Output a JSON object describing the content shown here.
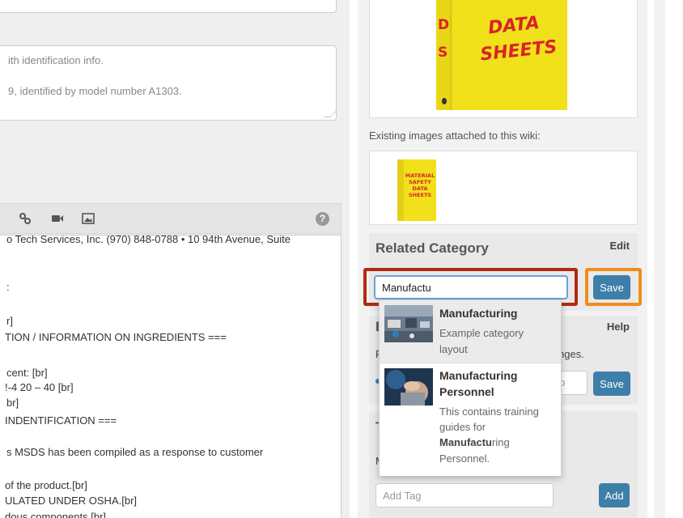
{
  "left": {
    "summary_line1": "ith identification info.",
    "summary_line2": "9, identified by model number A1303.",
    "help_icon": "?",
    "editor_lines": [
      "o Tech Services, Inc. (970) 848-0788 • 10 94th Avenue, Suite",
      ":",
      "r]",
      "TION / INFORMATION ON INGREDIENTS ===",
      "cent: [br]",
      "!-4 20 – 40 [br]",
      "br]",
      " INDENTIFICATION ===",
      "s MSDS has been compiled as a response to customer",
      "of the product.[br]",
      "ULATED UNDER OSHA.[br]",
      "dous components [br]"
    ]
  },
  "right": {
    "main_image_text": [
      "DATA",
      "SHEETS"
    ],
    "main_image_side_letters": [
      "D",
      "S"
    ],
    "existing_label": "Existing images attached to this wiki:",
    "thumb_text": [
      "MATERIAL",
      "SAFETY",
      "DATA",
      "SHEETS"
    ],
    "related": {
      "title": "Related Category",
      "edit": "Edit",
      "input_value": "Manufactu",
      "save": "Save"
    },
    "card2": {
      "title_frag": "E",
      "help": "Help",
      "f_frag": "F",
      "text_frag": "nges.",
      "input_frag": "o",
      "save": "Save"
    },
    "card3": {
      "title_frag": "T",
      "m_frag": "M",
      "tag_placeholder": "Add Tag",
      "add": "Add"
    },
    "suggestions": [
      {
        "title": "Manufacturing",
        "desc_lines": [
          "Example category",
          "layout"
        ]
      },
      {
        "title_lines": [
          "Manufacturing",
          "Personnel"
        ],
        "desc_lines": [
          "This contains training",
          "guides for"
        ],
        "desc_bold": "Manufactu",
        "desc_rest": "ring",
        "desc_last": "Personnel."
      }
    ]
  },
  "colors": {
    "highlight_red": "#b22a12",
    "highlight_orange": "#f08c1c",
    "button_blue": "#3d7fa8",
    "binder_yellow": "#f1e11a",
    "binder_red": "#d9232a"
  }
}
